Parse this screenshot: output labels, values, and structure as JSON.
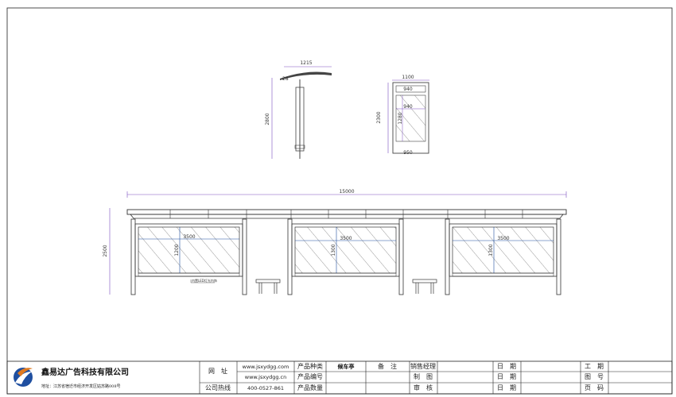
{
  "side_view": {
    "width_label": "1215",
    "height_label": "2800",
    "angle_label": "28"
  },
  "front_view": {
    "width_label": "1100",
    "inner_width_label": "940",
    "panel_width_label": "940",
    "panel_height_label": "1280",
    "height_label": "2300",
    "bottom_width_label": "950"
  },
  "main_view": {
    "total_width_label": "15000",
    "height_label": "2500",
    "panels": [
      {
        "width_label": "3500",
        "height_label": "1200"
      },
      {
        "width_label": "3500",
        "height_label": "1300"
      },
      {
        "width_label": "3500",
        "height_label": "1300"
      }
    ],
    "note": "内置LED灯光内饰"
  },
  "title_block": {
    "company": "鑫易达广告科技有限公司",
    "address": "地址：江苏省宿迁市经济开发区姑苏路008号",
    "row_labels": [
      "网　址",
      "公司热线"
    ],
    "websites": [
      "www.jsxydgg.com",
      "www.jsxydgg.cn"
    ],
    "hotline": "400-0527-861",
    "product_labels": [
      "产品种类",
      "产品编号",
      "产品数量"
    ],
    "product_type": "候车亭",
    "remark_label": "备　注",
    "role_labels": [
      "销售经理",
      "制　图",
      "审　核"
    ],
    "date_labels": [
      "日　期",
      "日　期",
      "日　期"
    ],
    "meta_labels": [
      "工　期",
      "图　号",
      "页　码"
    ]
  },
  "colors": {
    "line": "#333333",
    "dim": "#7a4fbf",
    "accent_blue": "#1f4fa0",
    "accent_orange": "#e07a1f"
  }
}
